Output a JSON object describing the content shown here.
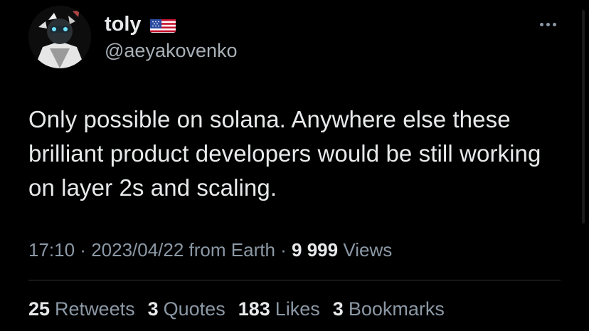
{
  "author": {
    "display_name": "toly",
    "handle": "@aeyakovenko",
    "flag_icon": "us-flag-icon"
  },
  "tweet": {
    "text": "Only possible on solana. Anywhere else these brilliant product developers would be still working on layer 2s and scaling."
  },
  "meta": {
    "time": "17:10",
    "separator": " · ",
    "date": "2023/04/22",
    "location": " from Earth",
    "separator2": " · ",
    "views_count": "9 999",
    "views_label": " Views"
  },
  "stats": {
    "retweets_count": "25",
    "retweets_label": "Retweets",
    "quotes_count": "3",
    "quotes_label": "Quotes",
    "likes_count": "183",
    "likes_label": "Likes",
    "bookmarks_count": "3",
    "bookmarks_label": "Bookmarks"
  },
  "colors": {
    "background": "#000000",
    "primary_text": "#e7e9ea",
    "secondary_text": "#8b98a5",
    "divider": "#2f3336"
  }
}
